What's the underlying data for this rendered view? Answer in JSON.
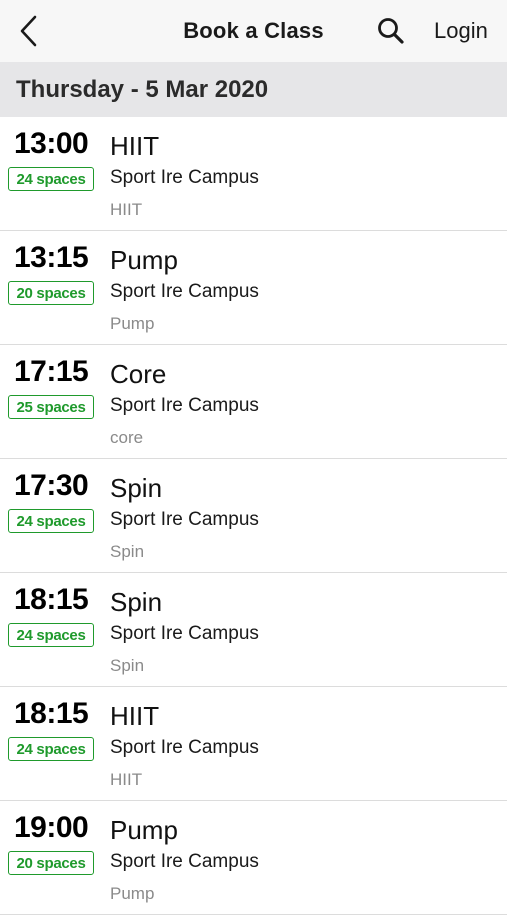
{
  "nav": {
    "title": "Book a Class",
    "login_label": "Login",
    "back_icon": "chevron-left-icon",
    "search_icon": "search-icon"
  },
  "date_header": "Thursday - 5 Mar 2020",
  "colors": {
    "accent_green": "#1f9a2c",
    "header_bg": "#e6e6e8",
    "nav_bg": "#f7f7f7",
    "muted_text": "#8a8a8a"
  },
  "classes": [
    {
      "time": "13:00",
      "spaces": "24 spaces",
      "name": "HIIT",
      "venue": "Sport Ire Campus",
      "category": "HIIT"
    },
    {
      "time": "13:15",
      "spaces": "20 spaces",
      "name": "Pump",
      "venue": "Sport Ire Campus",
      "category": "Pump"
    },
    {
      "time": "17:15",
      "spaces": "25 spaces",
      "name": "Core",
      "venue": "Sport Ire Campus",
      "category": "core"
    },
    {
      "time": "17:30",
      "spaces": "24 spaces",
      "name": "Spin",
      "venue": "Sport Ire Campus",
      "category": "Spin"
    },
    {
      "time": "18:15",
      "spaces": "24 spaces",
      "name": "Spin",
      "venue": "Sport Ire Campus",
      "category": "Spin"
    },
    {
      "time": "18:15",
      "spaces": "24 spaces",
      "name": "HIIT",
      "venue": "Sport Ire Campus",
      "category": "HIIT"
    },
    {
      "time": "19:00",
      "spaces": "20 spaces",
      "name": "Pump",
      "venue": "Sport Ire Campus",
      "category": "Pump"
    }
  ]
}
